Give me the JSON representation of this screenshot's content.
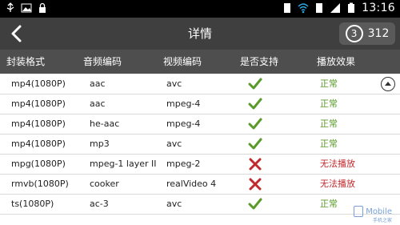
{
  "status_bar": {
    "time": "13:16",
    "left_icons": [
      "usb-icon",
      "image-icon",
      "lock-icon"
    ],
    "right_icons": [
      "sim-icon",
      "wifi-icon",
      "sim-icon",
      "signal-icon",
      "battery-icon"
    ]
  },
  "title_bar": {
    "title": "详情",
    "score": "312",
    "medal_number": "3"
  },
  "table": {
    "headers": [
      "封装格式",
      "音频编码",
      "视频编码",
      "是否支持",
      "播放效果"
    ],
    "rows": [
      {
        "format": "mp4(1080P)",
        "audio": "aac",
        "video": "avc",
        "supported": true,
        "effect": "正常"
      },
      {
        "format": "mp4(1080P)",
        "audio": "aac",
        "video": "mpeg-4",
        "supported": true,
        "effect": "正常"
      },
      {
        "format": "mp4(1080P)",
        "audio": "he-aac",
        "video": "mpeg-4",
        "supported": true,
        "effect": "正常"
      },
      {
        "format": "mp4(1080P)",
        "audio": "mp3",
        "video": "avc",
        "supported": true,
        "effect": "正常"
      },
      {
        "format": "mpg(1080P)",
        "audio": "mpeg-1 layer II",
        "video": "mpeg-2",
        "supported": false,
        "effect": "无法播放"
      },
      {
        "format": "rmvb(1080P)",
        "audio": "cooker",
        "video": "realVideo 4",
        "supported": false,
        "effect": "无法播放"
      },
      {
        "format": "ts(1080P)",
        "audio": "ac-3",
        "video": "avc",
        "supported": true,
        "effect": "正常"
      }
    ]
  },
  "watermark": {
    "text": "Mobile",
    "subtext": "手机之家"
  },
  "colors": {
    "ok_green": "#5a9a2a",
    "bad_red": "#c0292d",
    "title_bar_bg": "#3f3f3f",
    "header_bg": "#4e4e4e"
  }
}
